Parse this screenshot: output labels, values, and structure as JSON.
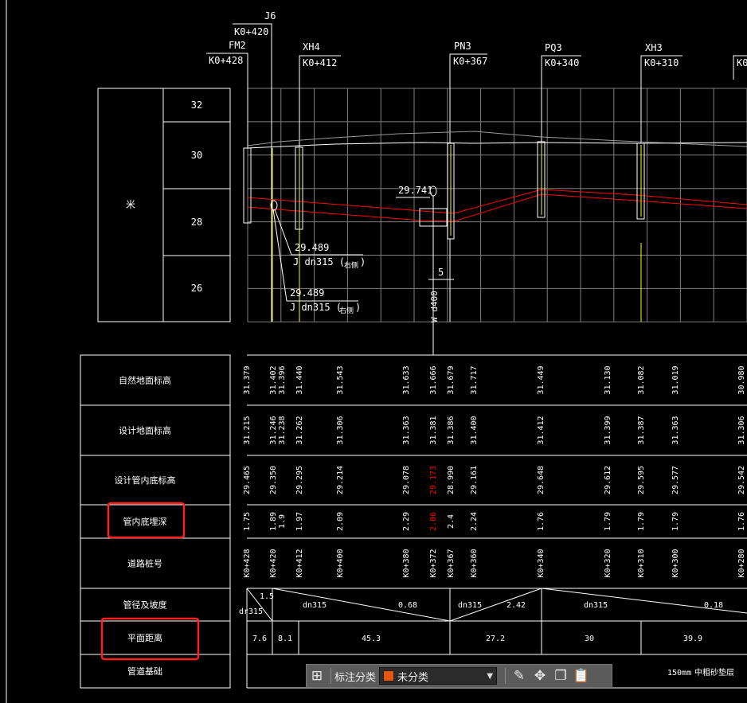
{
  "stations_header": [
    {
      "name": "J6",
      "chainage": "K0+420"
    },
    {
      "name": "FM2",
      "chainage": "K0+428"
    },
    {
      "name": "XH4",
      "chainage": "K0+412"
    },
    {
      "name": "PN3",
      "chainage": "K0+367"
    },
    {
      "name": "PQ3",
      "chainage": "K0+340"
    },
    {
      "name": "XH3",
      "chainage": "K0+310"
    },
    {
      "name": "",
      "chainage": "K0"
    }
  ],
  "elevation_scale": {
    "unit": "米",
    "ticks": [
      "32",
      "30",
      "28",
      "26"
    ]
  },
  "annotations": {
    "elev_top": "29.741",
    "elev_j1": "29.489",
    "pipe_j1": "J dn315 (",
    "note_j1": "右侧",
    "elev_j2": "29.489",
    "pipe_j2": "J dn315 (",
    "note_j2": "右侧",
    "paren_close": ")",
    "dim": "5",
    "w_pipe": "W d400"
  },
  "table": {
    "row_labels": [
      "自然地面标高",
      "设计地面标高",
      "设计管内底标高",
      "管内底埋深",
      "道路桩号",
      "管径及坡度",
      "平面距离",
      "管道基础"
    ],
    "ground": [
      "31.379",
      "31.402",
      "31.396",
      "31.440",
      "31.543",
      "31.633",
      "31.666",
      "31.679",
      "31.717",
      "31.449",
      "31.130",
      "31.082",
      "31.019",
      "30.980"
    ],
    "design_ground": [
      "31.215",
      "31.246",
      "31.238",
      "31.262",
      "31.306",
      "31.363",
      "31.381",
      "31.386",
      "31.400",
      "31.412",
      "31.399",
      "31.387",
      "31.363",
      "31.306"
    ],
    "invert": [
      "29.465",
      "29.350",
      null,
      "29.295",
      "29.214",
      "29.078",
      {
        "text": "29.173",
        "color": "#ff0000"
      },
      "28.990",
      "29.161",
      "29.648",
      "29.612",
      "29.595",
      "29.577",
      "29.542"
    ],
    "depth": [
      "1.75",
      "1.89",
      "1.9",
      "1.97",
      "2.09",
      "2.29",
      {
        "text": "2.06",
        "color": "#ff0000"
      },
      "2.4",
      "2.24",
      "1.76",
      "1.79",
      "1.79",
      "1.79",
      "1.76"
    ],
    "chainage": [
      "K0+428",
      "K0+420",
      null,
      "K0+412",
      "K0+400",
      "K0+380",
      "K0+372",
      "K0+367",
      "K0+360",
      "K0+340",
      "K0+320",
      "K0+310",
      "K0+300",
      "K0+280"
    ],
    "pipes": [
      {
        "size": "dr315",
        "slope": "1.5"
      },
      {
        "size": "dn315",
        "slope": "0.68"
      },
      {
        "size": "dn315",
        "slope": "2.42"
      },
      {
        "size": "dn315",
        "slope": "0.18"
      }
    ],
    "distances": [
      "7.6",
      "8.1",
      "45.3",
      "27.2",
      "30",
      "39.9"
    ],
    "foundation": {
      "thickness": "150mm",
      "material": "中粗砂垫层"
    }
  },
  "highlight_color": "#ff2020",
  "toolbar": {
    "label": "标注分类",
    "category": "未分类",
    "category_color": "#e8550c",
    "icons": [
      "grid-icon",
      "edit-icon",
      "move-icon",
      "copy-icon",
      "paste-icon"
    ]
  }
}
